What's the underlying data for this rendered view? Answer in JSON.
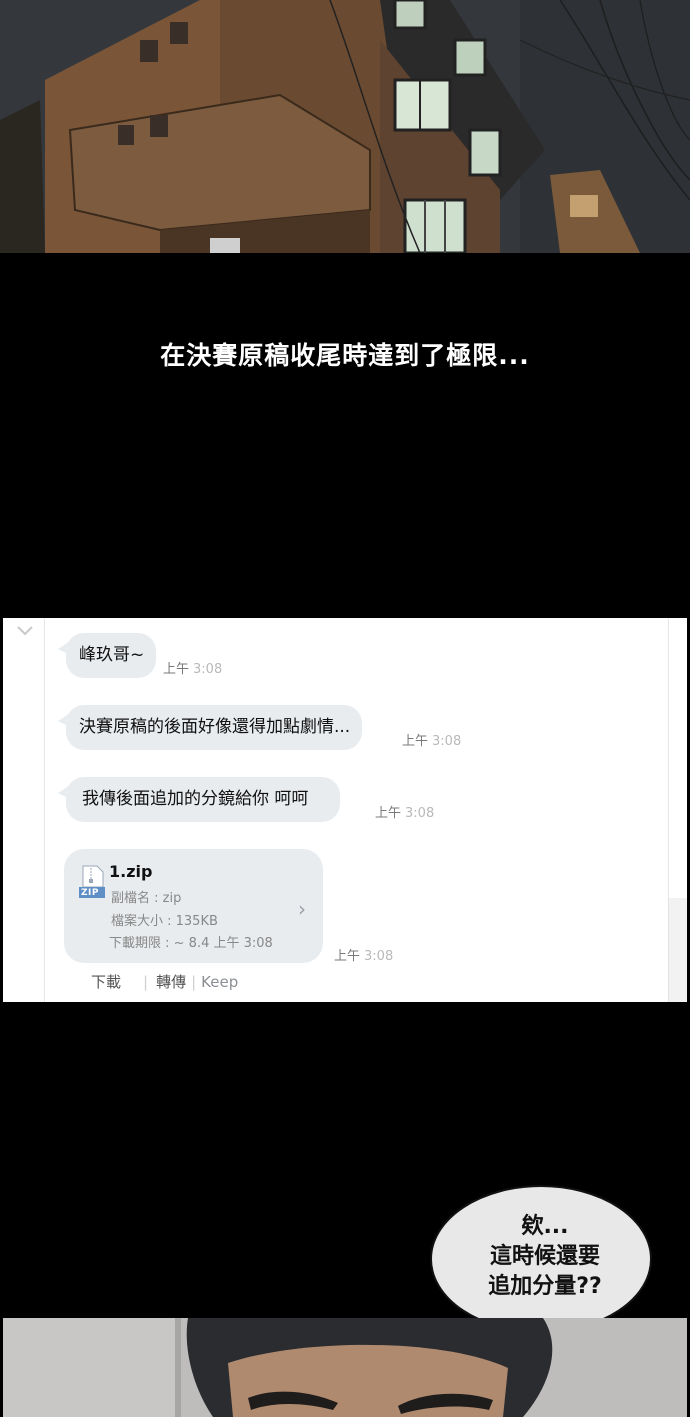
{
  "caption": "在決賽原稿收尾時達到了極限...",
  "chat": {
    "messages": [
      {
        "text": "峰玖哥~",
        "time_ampm": "上午",
        "time": "3:08"
      },
      {
        "text": "決賽原稿的後面好像還得加點劇情...",
        "time_ampm": "上午",
        "time": "3:08"
      },
      {
        "text": "我傳後面追加的分鏡給你 呵呵",
        "time_ampm": "上午",
        "time": "3:08"
      }
    ],
    "file": {
      "icon_label": "ZIP",
      "name": "1.zip",
      "ext_label": "副檔名 : zip",
      "size_label": "檔案大小 : 135KB",
      "expiry_label": "下載期限 : ~ 8.4  上午 3:08",
      "time_ampm": "上午",
      "time": "3:08"
    },
    "actions": {
      "download": "下載",
      "forward": "轉傳",
      "keep": "Keep"
    }
  },
  "thought_bubble": {
    "lines": [
      "欸...",
      "這時候還要",
      "追加分量??"
    ]
  },
  "colors": {
    "bubble": "#e9ecef",
    "page_bg": "#000000",
    "chat_bg": "#ffffff"
  }
}
